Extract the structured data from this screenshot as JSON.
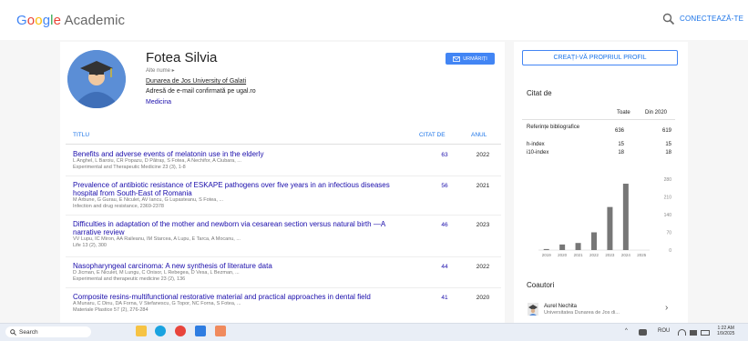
{
  "header": {
    "logo_google": [
      "G",
      "o",
      "o",
      "g",
      "l",
      "e"
    ],
    "logo_rest": " Academic",
    "signin_label": "CONECTEAZĂ-TE"
  },
  "profile": {
    "name": "Fotea Silvia",
    "other_names": "Alte nume ▸",
    "affiliation": "Dunarea de Jos University of Galati",
    "email": "Adresă de e-mail confirmată pe ugal.ro",
    "field": "Medicina",
    "follow_label": "URMĂRIȚI"
  },
  "table": {
    "col_title": "TITLU",
    "col_cited": "CITAT DE",
    "col_year": "ANUL",
    "articles": [
      {
        "title": "Benefits and adverse events of melatonin use in the elderly",
        "authors": "L Anghel, L Baroiu, CR Popazu, D Pătraș, S Fotea, A Nechifor, A Ciubara, ...",
        "venue": "Experimental and Therapeutic Medicine 23 (3), 1-8",
        "cited": "63",
        "year": "2022"
      },
      {
        "title": "Prevalence of antibiotic resistance of ESKAPE pathogens over five years in an infectious diseases hospital from South-East of Romania",
        "authors": "M Arbune, G Gurau, E Niculet, AV Iancu, G Lupasteanu, S Fotea, ...",
        "venue": "Infection and drug resistance, 2369-2378",
        "cited": "56",
        "year": "2021"
      },
      {
        "title": "Difficulties in adaptation of the mother and newborn via cesarean section versus natural birth —A narrative review",
        "authors": "VV Lupu, IC Miron, AA Raileanu, IM Starcea, A Lupu, E Tarca, A Mocanu, ...",
        "venue": "Life 13 (2), 300",
        "cited": "46",
        "year": "2023"
      },
      {
        "title": "Nasopharyngeal carcinoma: A new synthesis of literature data",
        "authors": "D Jicman, E Niculet, M Lungu, C Onisor, L Rebegea, D Vesa, L Bezman, ...",
        "venue": "Experimental and therapeutic medicine 23 (2), 136",
        "cited": "44",
        "year": "2022"
      },
      {
        "title": "Composite resins-multifunctional restorative material and practical approaches in dental field",
        "authors": "A Munaru, C Dinu, DA Forna, V Stefanescu, G Topor, NC Forna, S Fotea, ...",
        "venue": "Materiale Plastice 57 (2), 276-284",
        "cited": "41",
        "year": "2020"
      }
    ]
  },
  "sidebar": {
    "create_profile": "CREAȚI-VĂ PROPRIUL PROFIL",
    "cited_title": "Citat de",
    "col_all": "Toate",
    "col_since": "Din 2020",
    "stats": [
      {
        "label": "Referințe bibliografice",
        "all": "636",
        "since": "619"
      },
      {
        "label": "h-index",
        "all": "15",
        "since": "15"
      },
      {
        "label": "i10-index",
        "all": "18",
        "since": "18"
      }
    ],
    "coauthors_title": "Coautori",
    "coauthor": {
      "name": "Aurel Nechita",
      "affiliation": "Universitatea Dunarea de Jos di..."
    }
  },
  "chart_data": {
    "type": "bar",
    "categories": [
      "2019",
      "2020",
      "2021",
      "2022",
      "2023",
      "2024",
      "2025"
    ],
    "values": [
      4,
      22,
      28,
      70,
      170,
      262,
      0
    ],
    "ylim": [
      0,
      280
    ],
    "yticks": [
      "280",
      "210",
      "140",
      "70",
      "0"
    ],
    "bar_color": "#777777"
  },
  "taskbar": {
    "search_placeholder": "Search",
    "tray_lang": "ROU",
    "time": "1:22 AM",
    "date": "1/9/2025"
  }
}
